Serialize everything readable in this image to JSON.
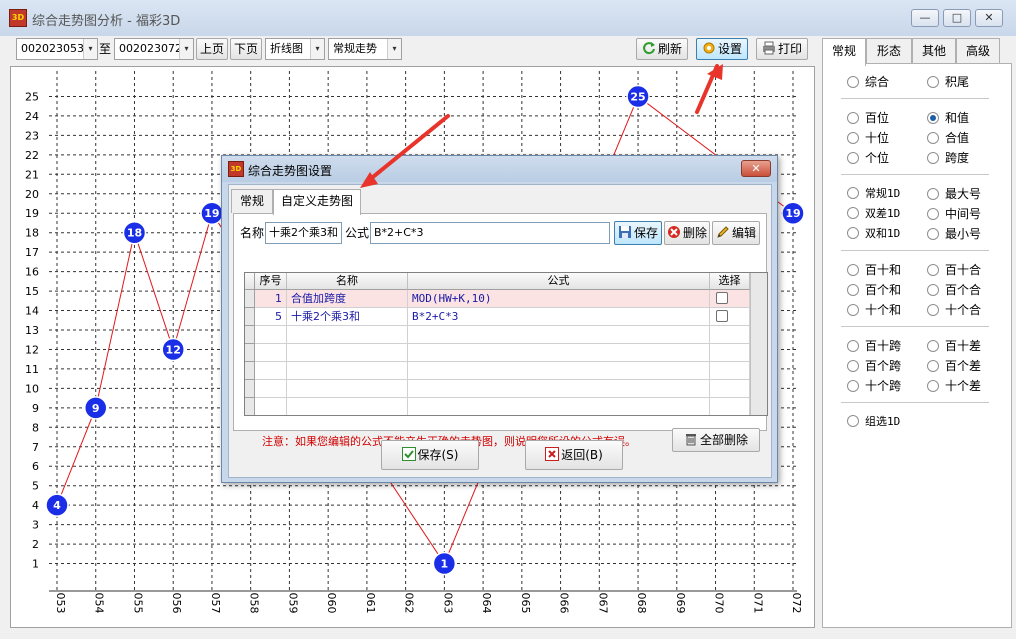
{
  "window": {
    "title": "综合走势图分析 - 福彩3D",
    "icon_text": "3D",
    "min_glyph": "—",
    "max_glyph": "□",
    "close_glyph": "✕"
  },
  "toolbar": {
    "from_period": "002023053",
    "to_label": "至",
    "to_period": "002023072",
    "prev_page": "上页",
    "next_page": "下页",
    "chart_style": "折线图",
    "trend_type": "常规走势",
    "refresh": "刷新",
    "settings": "设置",
    "print": "打印",
    "dropdown_glyph": "▾"
  },
  "chart_data": {
    "type": "line",
    "x": [
      "053",
      "054",
      "055",
      "056",
      "057",
      "058",
      "059",
      "060",
      "061",
      "062",
      "063",
      "064",
      "065",
      "066",
      "067",
      "068",
      "069",
      "070",
      "071",
      "072"
    ],
    "y_ticks": [
      1,
      2,
      3,
      4,
      5,
      6,
      7,
      8,
      9,
      10,
      11,
      12,
      13,
      14,
      15,
      16,
      17,
      18,
      19,
      20,
      21,
      22,
      23,
      24,
      25
    ],
    "ylim": [
      0,
      26
    ],
    "grid": true,
    "line_color": "#e0181b",
    "marker_color": "#1a2ee8",
    "series": [
      {
        "points": [
          {
            "x": "053",
            "y": 4
          },
          {
            "x": "054",
            "y": 9
          },
          {
            "x": "055",
            "y": 18
          },
          {
            "x": "056",
            "y": 12
          },
          {
            "x": "057",
            "y": 19
          },
          {
            "x": "063",
            "y": 1
          },
          {
            "x": "068",
            "y": 25
          },
          {
            "x": "072",
            "y": 19
          }
        ]
      }
    ]
  },
  "right_panel": {
    "tabs": [
      "常规",
      "形态",
      "其他",
      "高级"
    ],
    "active_tab": "常规",
    "groups": [
      [
        [
          "综合",
          "积尾"
        ]
      ],
      [
        [
          "百位",
          "和值"
        ],
        [
          "十位",
          "合值"
        ],
        [
          "个位",
          "跨度"
        ]
      ],
      [
        [
          "常规1D",
          "最大号"
        ],
        [
          "双差1D",
          "中间号"
        ],
        [
          "双和1D",
          "最小号"
        ]
      ],
      [
        [
          "百十和",
          "百十合"
        ],
        [
          "百个和",
          "百个合"
        ],
        [
          "十个和",
          "十个合"
        ]
      ],
      [
        [
          "百十跨",
          "百十差"
        ],
        [
          "百个跨",
          "百个差"
        ],
        [
          "十个跨",
          "十个差"
        ]
      ],
      [
        [
          "组选1D"
        ]
      ]
    ],
    "selected": "和值"
  },
  "dialog": {
    "title": "综合走势图设置",
    "icon_text": "3D",
    "close_glyph": "✕",
    "tabs": [
      "常规",
      "自定义走势图"
    ],
    "active_tab": "自定义走势图",
    "name_label": "名称",
    "name_value": "十乘2个乘3和",
    "formula_label": "公式",
    "formula_value": "B*2+C*3",
    "save_small": "保存",
    "delete": "删除",
    "edit": "编辑",
    "columns": [
      "序号",
      "名称",
      "公式",
      "选择"
    ],
    "rows": [
      {
        "no": "1",
        "name": "合值加跨度",
        "formula": "MOD(HW+K,10)"
      },
      {
        "no": "5",
        "name": "十乘2个乘3和",
        "formula": "B*2+C*3"
      }
    ],
    "warning": "注意：如果您编辑的公式不能产生正确的走势图，则说明您所设的公式有误。",
    "delete_all": "全部删除",
    "save_btn": "保存(S)",
    "back_btn": "返回(B)"
  },
  "colors": {
    "arrow": "#e8342a",
    "accent": "#1d5fa8",
    "warning": "#d10000",
    "formula_text": "#1a1aa6"
  }
}
